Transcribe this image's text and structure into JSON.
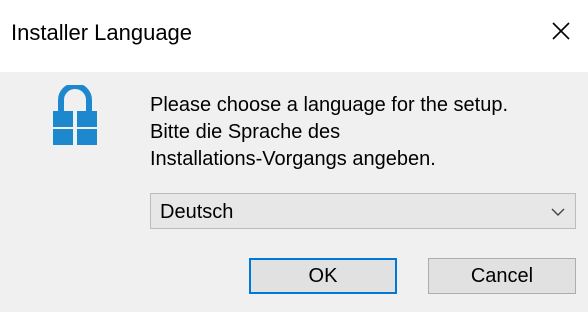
{
  "window": {
    "title": "Installer Language"
  },
  "message": {
    "lines": [
      "Please choose a language for the setup.",
      "Bitte die Sprache des",
      "Installations-Vorgangs angeben."
    ]
  },
  "language_select": {
    "selected": "Deutsch"
  },
  "buttons": {
    "ok_label": "OK",
    "cancel_label": "Cancel"
  },
  "icons": {
    "lock": "lock-icon",
    "close": "close-icon",
    "dropdown": "chevron-down-icon"
  },
  "colors": {
    "accent": "#0078d7",
    "icon_blue": "#1e88cf"
  }
}
